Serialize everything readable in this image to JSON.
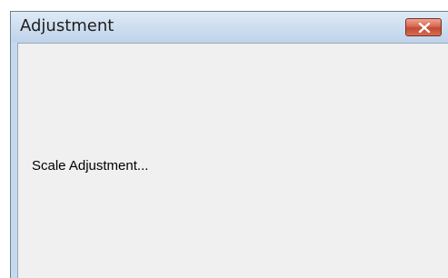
{
  "window": {
    "title": "Adjustment",
    "close_icon": "close-x-icon"
  },
  "content": {
    "message": "Scale Adjustment..."
  },
  "colors": {
    "titlebar": "#cfdff0",
    "client_background": "#f0f0f0",
    "close_button": "#d9674f"
  }
}
